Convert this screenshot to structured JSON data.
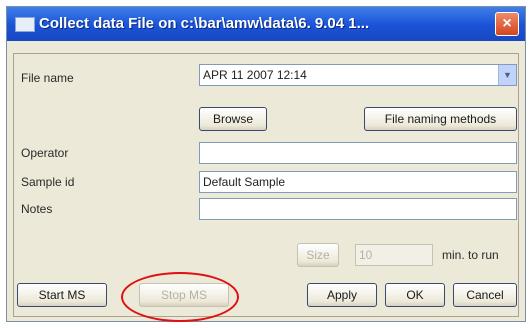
{
  "window": {
    "title": "Collect data File on c:\\bar\\amw\\data\\6. 9.04 1...",
    "close_icon": "×"
  },
  "form": {
    "file_name_label": "File name",
    "file_name_value": "APR 11 2007 12:14",
    "browse_label": "Browse",
    "naming_methods_label": "File naming methods",
    "operator_label": "Operator",
    "operator_value": "",
    "sample_id_label": "Sample id",
    "sample_id_value": "Default Sample",
    "notes_label": "Notes",
    "notes_value": "",
    "size_label": "Size",
    "size_value": "10",
    "units_label": "min. to run"
  },
  "buttons": {
    "start_ms": "Start MS",
    "stop_ms": "Stop MS",
    "apply": "Apply",
    "ok": "OK",
    "cancel": "Cancel"
  },
  "colors": {
    "highlight_ellipse": "#e01010"
  }
}
